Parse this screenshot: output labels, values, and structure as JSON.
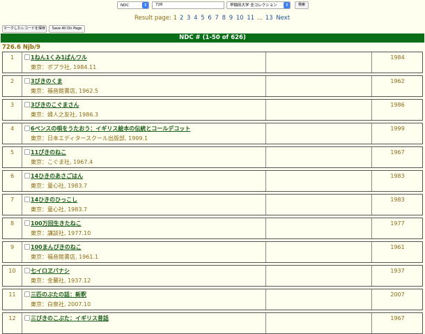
{
  "search": {
    "field_select": "NDC",
    "query_value": "726",
    "scope_select": "早稲田大学 全コレクション",
    "search_button": "検索"
  },
  "pager": {
    "label": "Result page:",
    "current": "1",
    "pages": [
      "2",
      "3",
      "4",
      "5",
      "6",
      "7",
      "8",
      "9",
      "10",
      "11"
    ],
    "ellipsis": "...",
    "last": "13",
    "next": "Next"
  },
  "toolbar": {
    "save_marked": "マークしたレコードを保存",
    "save_all": "Save All On Page"
  },
  "header": {
    "title": "NDC # (1-50 of 626)"
  },
  "call_number": "726.6 Njb/9",
  "rows": [
    {
      "num": "1",
      "title": "1ねん1くみ1ばんワル",
      "pub": "東京：ポプラ社, 1984.11",
      "year": "1984"
    },
    {
      "num": "2",
      "title": "3びきのくま",
      "pub": "東京：福音館書店, 1962.5",
      "year": "1962"
    },
    {
      "num": "3",
      "title": "3びきのこぐまさん",
      "pub": "東京：婦人之友社, 1986.3",
      "year": "1986"
    },
    {
      "num": "4",
      "title": "6ペンスの唄をうたおう：イギリス絵本の伝統とコールデコット",
      "pub": "東京：日本エディタースクール出版部, 1999.1",
      "year": "1999"
    },
    {
      "num": "5",
      "title": "11ぴきのねこ",
      "pub": "東京：こぐま社, 1967.4",
      "year": "1967"
    },
    {
      "num": "6",
      "title": "14ひきのあさごはん",
      "pub": "東京：童心社, 1983.7",
      "year": "1983"
    },
    {
      "num": "7",
      "title": "14ひきのひっこし",
      "pub": "東京：童心社, 1983.7",
      "year": "1983"
    },
    {
      "num": "8",
      "title": "100万回生きたねこ",
      "pub": "東京：講談社, 1977.10",
      "year": "1977"
    },
    {
      "num": "9",
      "title": "100まんびきのねこ",
      "pub": "東京：福音館書店, 1961.1",
      "year": "1961"
    },
    {
      "num": "10",
      "title": "七イロヱバナシ",
      "pub": "東京：金蘭社, 1937.12",
      "year": "1937"
    },
    {
      "num": "11",
      "title": "三匹のぶたの話：新釈",
      "pub": "東京：白泉社, 2007.10",
      "year": "2007"
    },
    {
      "num": "12",
      "title": "三びきのこぶた：イギリス昔話",
      "pub": "",
      "year": "1967"
    }
  ]
}
